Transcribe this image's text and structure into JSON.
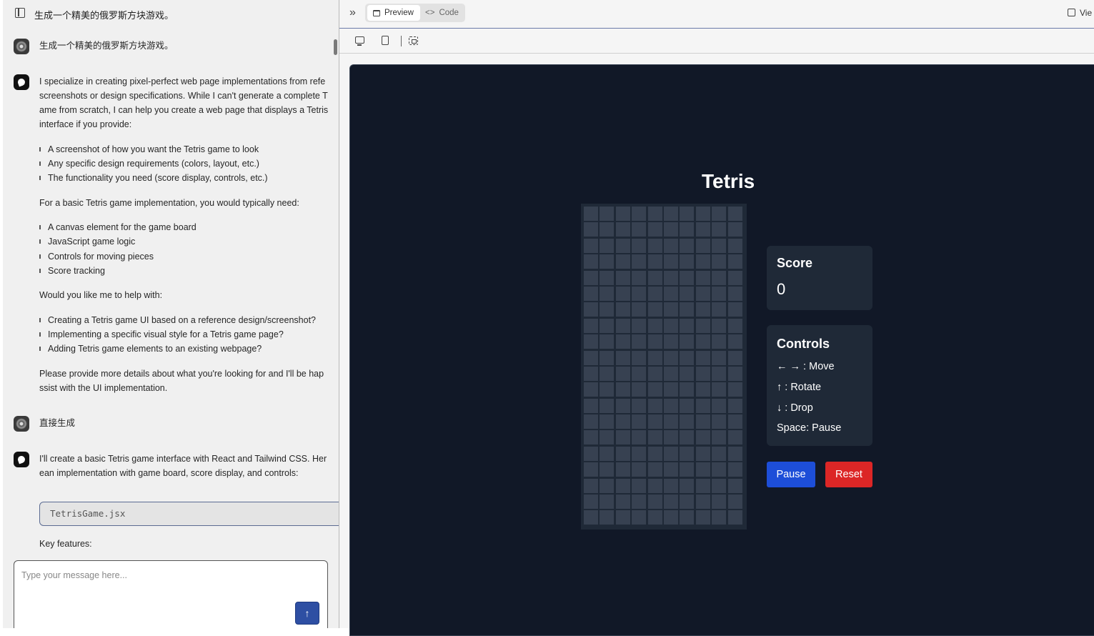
{
  "chat": {
    "title": "生成一个精美的俄罗斯方块游戏。",
    "user_msg_1": "生成一个精美的俄罗斯方块游戏。",
    "bot_msg_1": {
      "lines": [
        "I specialize in creating pixel-perfect web page implementations from refe",
        "screenshots or design specifications. While I can't generate a complete T",
        "ame from scratch, I can help you create a web page that displays a Tetris",
        "interface if you provide:"
      ],
      "bullets_1": [
        "A screenshot of how you want the Tetris game to look",
        "Any specific design requirements (colors, layout, etc.)",
        "The functionality you need (score display, controls, etc.)"
      ],
      "para_2": "For a basic Tetris game implementation, you would typically need:",
      "bullets_2": [
        "A canvas element for the game board",
        "JavaScript game logic",
        "Controls for moving pieces",
        "Score tracking"
      ],
      "para_3": "Would you like me to help with:",
      "bullets_3": [
        "Creating a Tetris game UI based on a reference design/screenshot?",
        "Implementing a specific visual style for a Tetris game page?",
        "Adding Tetris game elements to an existing webpage?"
      ],
      "para_4_line_1": "Please provide more details about what you're looking for and I'll be hap",
      "para_4_line_2": "ssist with the UI implementation."
    },
    "user_msg_2": "直接生成",
    "bot_msg_2": {
      "line_1": "I'll create a basic Tetris game interface with React and Tailwind CSS. Her",
      "line_2": "ean implementation with game board, score display, and controls:",
      "code_file": "TetrisGame.jsx",
      "key_features": "Key features:"
    },
    "composer": {
      "placeholder": "Type your message here...",
      "send_icon": "arrow-up-icon"
    }
  },
  "preview": {
    "tabs": {
      "preview": "Preview",
      "code": "Code"
    },
    "view_link": "Vie",
    "game": {
      "title": "Tetris",
      "board": {
        "columns": 10,
        "rows": 20
      },
      "score_label": "Score",
      "score_value": "0",
      "controls_title": "Controls",
      "controls": [
        "← → : Move",
        "↑ : Rotate",
        "↓ : Drop",
        "Space: Pause"
      ],
      "pause_label": "Pause",
      "reset_label": "Reset"
    }
  },
  "colors": {
    "stage_bg": "#111827",
    "panel_bg": "#1f2937",
    "cell_bg": "#374151",
    "pause_button": "#1d4ed8",
    "reset_button": "#dc2626",
    "send_button": "#2e4fa3"
  }
}
